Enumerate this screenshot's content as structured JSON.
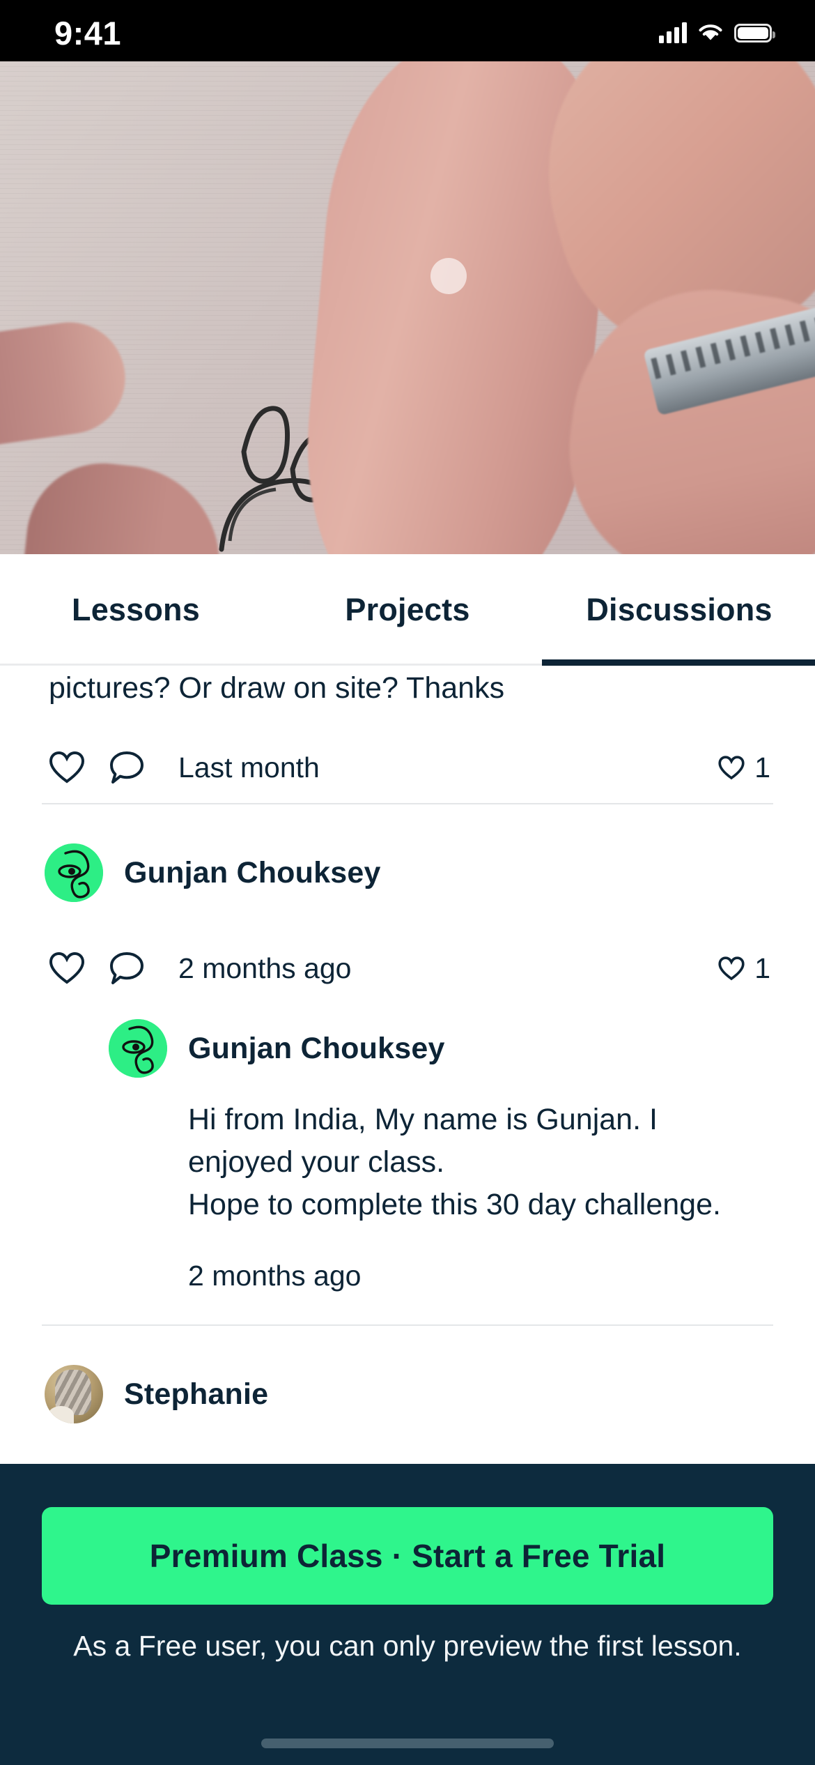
{
  "status_bar": {
    "time": "9:41",
    "icons": [
      "cellular-signal-icon",
      "wifi-icon",
      "battery-icon"
    ]
  },
  "video": {
    "state": "buffering",
    "indicator": "circular-progress-indicator",
    "description": "hand drawing with marker on paper"
  },
  "tabs": [
    {
      "label": "Lessons",
      "active": false
    },
    {
      "label": "Projects",
      "active": false
    },
    {
      "label": "Discussions",
      "active": true
    }
  ],
  "discussions": {
    "clipped_comment_text": "pictures? Or draw on site? Thanks",
    "comments": [
      {
        "author": "",
        "body": "",
        "time": "Last month",
        "like_count": "1",
        "avatar": "none"
      },
      {
        "author": "Gunjan Chouksey",
        "body": "",
        "time": "2 months ago",
        "like_count": "1",
        "avatar": "green-line-art-face"
      },
      {
        "author": "Stephanie",
        "body": "",
        "time": "",
        "like_count": "",
        "avatar": "photo"
      }
    ],
    "reply": {
      "author": "Gunjan Chouksey",
      "body": "Hi from India, My name is Gunjan. I\nenjoyed your class.\nHope to complete this 30 day challenge.",
      "time": "2 months ago",
      "avatar": "green-line-art-face"
    }
  },
  "bottom_bar": {
    "cta_label": "Premium Class · Start a Free Trial",
    "note": "As a Free user, you can only preview the first lesson.",
    "accent_color": "#2FF58C",
    "background_color": "#0d2b3e"
  }
}
